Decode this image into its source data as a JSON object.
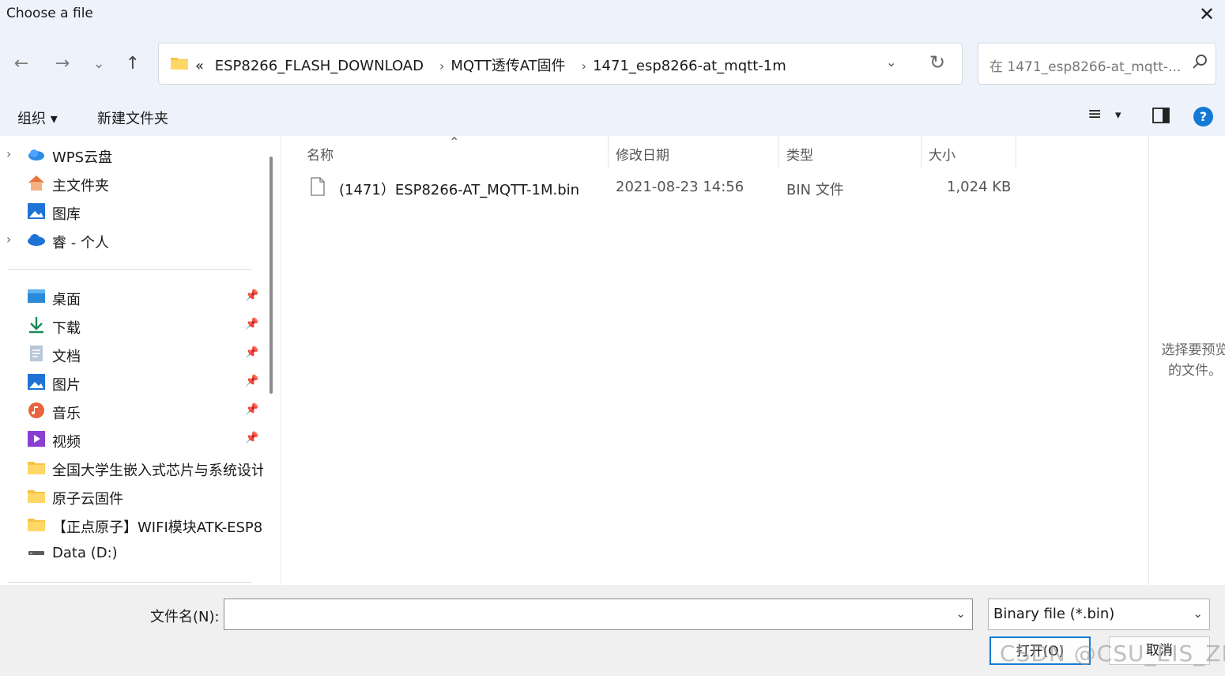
{
  "window": {
    "title": "Choose a file",
    "close_glyph": "✕"
  },
  "nav": {
    "back_glyph": "←",
    "forward_glyph": "→",
    "recent_glyph": "⌄",
    "up_glyph": "↑",
    "breadcrumb_overflow": "«",
    "breadcrumbs": [
      "ESP8266_FLASH_DOWNLOAD",
      "MQTT透传AT固件",
      "1471_esp8266-at_mqtt-1m"
    ],
    "separator": "›",
    "dropdown_glyph": "⌄",
    "refresh_glyph": "↻",
    "search_placeholder": "在 1471_esp8266-at_mqtt-...",
    "search_glyph": "⌕"
  },
  "toolbar": {
    "organize_label": "组织 ▾",
    "new_folder_label": "新建文件夹",
    "view_glyph": "≡",
    "view_dd_glyph": "▾",
    "preview_glyph": "▢",
    "help_glyph": "?"
  },
  "sidebar": {
    "items": [
      {
        "label": "WPS云盘",
        "icon": "wps-cloud-icon",
        "expandable": true
      },
      {
        "label": "主文件夹",
        "icon": "home-icon",
        "expandable": false
      },
      {
        "label": "图库",
        "icon": "gallery-icon",
        "expandable": false
      },
      {
        "label": "睿 - 个人",
        "icon": "onedrive-icon",
        "expandable": true
      }
    ],
    "pinned": [
      {
        "label": "桌面",
        "icon": "desktop-icon"
      },
      {
        "label": "下载",
        "icon": "download-icon"
      },
      {
        "label": "文档",
        "icon": "documents-icon"
      },
      {
        "label": "图片",
        "icon": "pictures-icon"
      },
      {
        "label": "音乐",
        "icon": "music-icon"
      },
      {
        "label": "视频",
        "icon": "videos-icon"
      }
    ],
    "folders": [
      {
        "label": "全国大学生嵌入式芯片与系统设计",
        "icon": "folder-icon"
      },
      {
        "label": "原子云固件",
        "icon": "folder-icon"
      },
      {
        "label": "【正点原子】WIFI模块ATK-ESP8",
        "icon": "folder-icon"
      },
      {
        "label": "Data (D:)",
        "icon": "drive-icon"
      }
    ],
    "chevron_glyph": "›",
    "pin_glyph": "📌"
  },
  "files": {
    "sort_glyph": "⌃",
    "columns": {
      "name": "名称",
      "date": "修改日期",
      "type": "类型",
      "size": "大小"
    },
    "rows": [
      {
        "name": "(1471）ESP8266-AT_MQTT-1M.bin",
        "date": "2021-08-23 14:56",
        "type": "BIN 文件",
        "size": "1,024 KB"
      }
    ]
  },
  "preview": {
    "line1": "选择要预览",
    "line2": "的文件。"
  },
  "footer": {
    "filename_label": "文件名(N):",
    "filename_value": "",
    "filetype_value": "Binary file (*.bin)",
    "open_label": "打开(O)",
    "cancel_label": "取消",
    "watermark": "CSDN @CSU_EIS_ZR",
    "dd_glyph": "⌄"
  },
  "colors": {
    "chrome": "#eef3fb",
    "accent": "#1479d6",
    "folder": "#f6c343",
    "footer": "#f0f0f0"
  }
}
